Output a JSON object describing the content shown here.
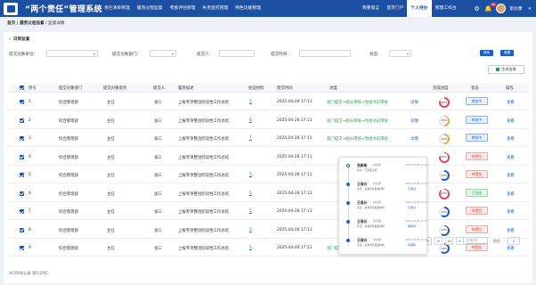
{
  "app": {
    "title": "“两个责任”管理系统"
  },
  "nav": {
    "left": [
      "责任清单管理",
      "履责过程监督",
      "考核评估管理",
      "失责追究管理",
      "特色功能管理"
    ],
    "right": [
      "我要留言",
      "首页门户",
      "个人待办",
      "管理工作台"
    ],
    "active_index": 2,
    "message_count": "10",
    "user_name": "李达康"
  },
  "breadcrumb": {
    "parent": "首页 | 履责过程监督",
    "current": "监督详情"
  },
  "card": {
    "title": "日常监督",
    "back_icon": "chevron-left-icon"
  },
  "filters": {
    "unit_label": "提交对象单位:",
    "dept_label": "提交对象部门:",
    "person_label": "提交人:",
    "time_label": "提交时间:",
    "status_label": "状态:",
    "search_label": "搜索",
    "reset_label": "重置",
    "export_label": "生成台账"
  },
  "table": {
    "headers": [
      "序号",
      "提交对象部门",
      "提交对象职务",
      "提交人",
      "履责描述",
      "佐证材料",
      "提交时间",
      "进度",
      "完成进度",
      "状态",
      "操作"
    ],
    "rows": [
      {
        "no": "1",
        "dept": "综合管理部",
        "post": "主任",
        "person": "张三",
        "desc": "上报专项整治阶段性工作总结",
        "files": "5",
        "time": "2025-04-28 17:11",
        "progress": "部门提交→组长审核→党组书记审核",
        "detail": "详情",
        "pct": 80,
        "pct_label": "80%",
        "status": "审核中",
        "status_type": "reviewing",
        "op": "查看"
      },
      {
        "no": "2",
        "dept": "综合管理部",
        "post": "主任",
        "person": "张三",
        "desc": "上报专项整治阶段性工作总结",
        "files": "6",
        "time": "2025-04-28 17:11",
        "progress": "部门提交→组长审核→党组书记审核",
        "detail": "详情",
        "pct": 50,
        "pct_label": "50%",
        "status": "审核中",
        "status_type": "reviewing",
        "op": "查看"
      },
      {
        "no": "3",
        "dept": "综合管理部",
        "post": "主任",
        "person": "张三",
        "desc": "上报专项整治阶段性工作总结",
        "files": "7",
        "time": "2025-04-28 17:11",
        "progress": "部门提交→组长审核→党组书记审核",
        "detail": "详情",
        "pct": 50,
        "pct_label": "50%",
        "status": "审核中",
        "status_type": "reviewing",
        "op": "查看"
      },
      {
        "no": "4",
        "dept": "综合管理部",
        "post": "主任",
        "person": "张三",
        "desc": "上报专项整治阶段性工作总结",
        "files": "",
        "time": "2025-04-28 17:11",
        "progress": "",
        "detail": "",
        "pct": 80,
        "pct_label": "80%",
        "status": "待提交",
        "status_type": "submitted",
        "op": "查看"
      },
      {
        "no": "5",
        "dept": "综合管理部",
        "post": "主任",
        "person": "张三",
        "desc": "上报专项整治阶段性工作总结",
        "files": "5",
        "time": "2025-04-28 17:11",
        "progress": "",
        "detail": "",
        "pct": 60,
        "pct_label": "60%",
        "status": "待提交",
        "status_type": "submitted",
        "op": "查看"
      },
      {
        "no": "6",
        "dept": "综合管理部",
        "post": "主任",
        "person": "张三",
        "desc": "上报专项整治阶段性工作总结",
        "files": "5",
        "time": "2025-04-28 17:11",
        "progress": "",
        "detail": "",
        "pct": 90,
        "pct_label": "90%",
        "status": "已完成",
        "status_type": "done",
        "op": "查看"
      },
      {
        "no": "7",
        "dept": "综合管理部",
        "post": "主任",
        "person": "张三",
        "desc": "上报专项整治阶段性工作总结",
        "files": "5",
        "time": "2025-04-28 17:11",
        "progress": "",
        "detail": "",
        "pct": 60,
        "pct_label": "60%",
        "status": "待提交",
        "status_type": "submitted",
        "op": "查看"
      },
      {
        "no": "8",
        "dept": "综合管理部",
        "post": "主任",
        "person": "张三",
        "desc": "上报专项整治阶段性工作总结",
        "files": "5",
        "time": "2025-04-28 17:11",
        "progress": "",
        "detail": "",
        "pct": 60,
        "pct_label": "60%",
        "status": "待提交",
        "status_type": "submitted",
        "op": "查看"
      },
      {
        "no": "9",
        "dept": "综合管理部",
        "post": "主任",
        "person": "张三",
        "desc": "上报专项整治阶段性工作总结",
        "files": "5",
        "time": "2025-04-28 17:11",
        "progress": "部门提交→组长审核→党组书记审核",
        "detail": "详情",
        "pct": 60,
        "pct_label": "60%",
        "status": "待提交",
        "status_type": "submitted",
        "op": "查看"
      }
    ]
  },
  "timeline": [
    {
      "name": "张新新",
      "role": "综合部",
      "time": "2025-04-28 17:11",
      "note": "提交：已完成上报",
      "tag": ""
    },
    {
      "name": "王局长",
      "role": "综合部",
      "time": "2025-04-28 17:11",
      "note": "意见：基本同意报送材料",
      "tag": "已通过"
    },
    {
      "name": "王局长",
      "role": "综合部",
      "time": "2025-04-28 17:11",
      "note": "意见：基本同意报送材料",
      "tag": "已通过"
    },
    {
      "name": "王局长",
      "role": "综合部",
      "time": "2025-04-28 17:11",
      "note": "意见：基本同意报送材料",
      "tag": "审核中"
    },
    {
      "name": "王局长",
      "role": "综合部",
      "time": "2025-04-28 17:11",
      "note": "意见：基本同意报送材料",
      "tag": "待审核"
    }
  ],
  "pagination": {
    "info": "共100条记录 第1/10页",
    "pages": [
      "<",
      "1",
      "2",
      "3",
      "4",
      "5",
      "6",
      "7",
      "8",
      "9",
      "10",
      ">"
    ],
    "active": "1",
    "jump_placeholder": "10条/页",
    "goto_label": "前往",
    "goto_value": "1"
  },
  "colors": {
    "primary": "#1d4fa3",
    "accent": "#1d5fc9",
    "done": "#2e9d4f",
    "warn": "#d9483b"
  }
}
